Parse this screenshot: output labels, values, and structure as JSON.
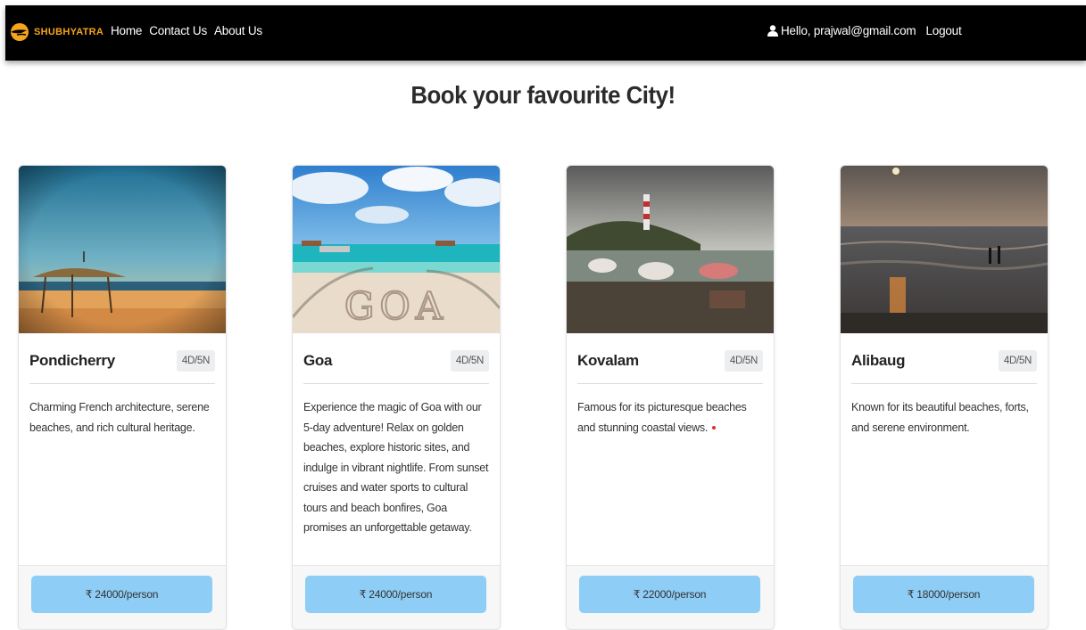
{
  "brand": {
    "name": "SHUBHYATRA",
    "accent": "#f5a41c"
  },
  "nav": {
    "items": [
      "Home",
      "Contact Us",
      "About Us"
    ]
  },
  "user": {
    "icon": "user-icon",
    "greeting": "Hello, prajwal@gmail.com",
    "logout": "Logout"
  },
  "page": {
    "title": "Book your favourite City!"
  },
  "colors": {
    "navbar": "#000000",
    "price_button": "#8ecdf5",
    "badge": "#eceeef"
  },
  "cards": [
    {
      "city": "Pondicherry",
      "duration": "4D/5N",
      "description": "Charming French architecture, serene beaches, and rich cultural heritage.",
      "price": "₹ 24000/person",
      "image": "beach-hut-photo"
    },
    {
      "city": "Goa",
      "duration": "4D/5N",
      "description": "Experience the magic of Goa with our 5-day adventure! Relax on golden beaches, explore historic sites, and indulge in vibrant nightlife. From sunset cruises and water sports to cultural tours and beach bonfires, Goa promises an unforgettable getaway.",
      "price": "₹ 24000/person",
      "image": "goa-sand-writing-photo"
    },
    {
      "city": "Kovalam",
      "duration": "4D/5N",
      "description": "Famous for its picturesque beaches and stunning coastal views.",
      "price": "₹ 22000/person",
      "image": "lighthouse-beach-photo"
    },
    {
      "city": "Alibaug",
      "duration": "4D/5N",
      "description": "Known for its beautiful beaches, forts, and serene environment.",
      "price": "₹ 18000/person",
      "image": "sunset-beach-photo"
    }
  ]
}
